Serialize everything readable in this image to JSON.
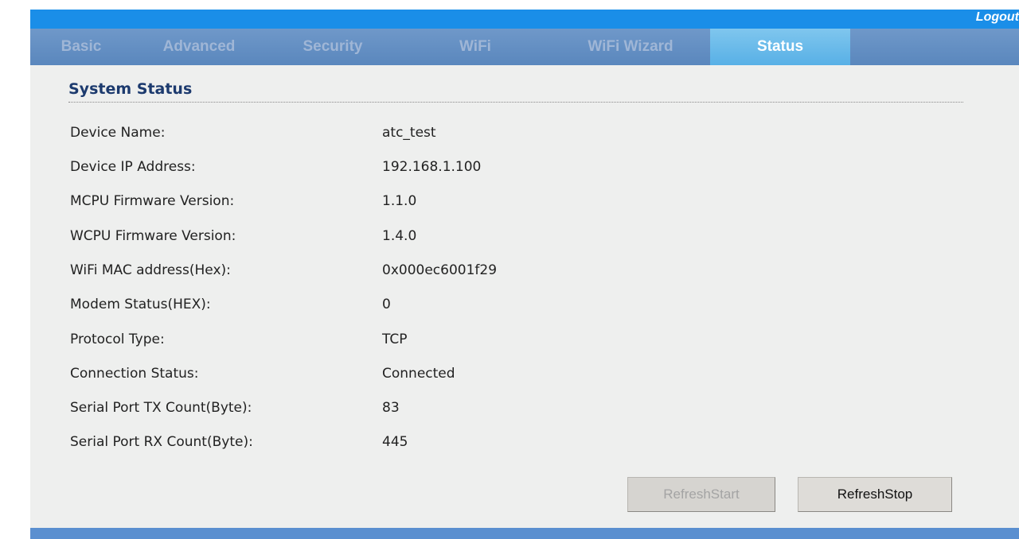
{
  "header": {
    "logout_label": "Logout"
  },
  "nav": {
    "tabs": [
      {
        "label": "Basic",
        "active": false
      },
      {
        "label": "Advanced",
        "active": false
      },
      {
        "label": "Security",
        "active": false
      },
      {
        "label": "WiFi",
        "active": false
      },
      {
        "label": "WiFi Wizard",
        "active": false
      },
      {
        "label": "Status",
        "active": true
      }
    ]
  },
  "status": {
    "title": "System Status",
    "rows": [
      {
        "label": "Device Name:",
        "value": "atc_test"
      },
      {
        "label": "Device IP Address:",
        "value": "192.168.1.100"
      },
      {
        "label": "MCPU Firmware Version:",
        "value": "1.1.0"
      },
      {
        "label": "WCPU Firmware Version:",
        "value": "1.4.0"
      },
      {
        "label": "WiFi MAC address(Hex):",
        "value": "0x000ec6001f29"
      },
      {
        "label": "Modem Status(HEX):",
        "value": "0"
      },
      {
        "label": "Protocol Type:",
        "value": "TCP"
      },
      {
        "label": "Connection Status:",
        "value": "Connected"
      },
      {
        "label": "Serial Port TX Count(Byte):",
        "value": "83"
      },
      {
        "label": "Serial Port RX Count(Byte):",
        "value": "445"
      }
    ]
  },
  "buttons": {
    "refresh_start_label": "RefreshStart",
    "refresh_start_enabled": false,
    "refresh_stop_label": "RefreshStop",
    "refresh_stop_enabled": true
  },
  "colors": {
    "top_bar": "#1a8ee8",
    "nav_bar": "#5a87bd",
    "active_tab": "#58b0e6",
    "content_bg": "#eeefee",
    "title_text": "#1c3a6e"
  }
}
